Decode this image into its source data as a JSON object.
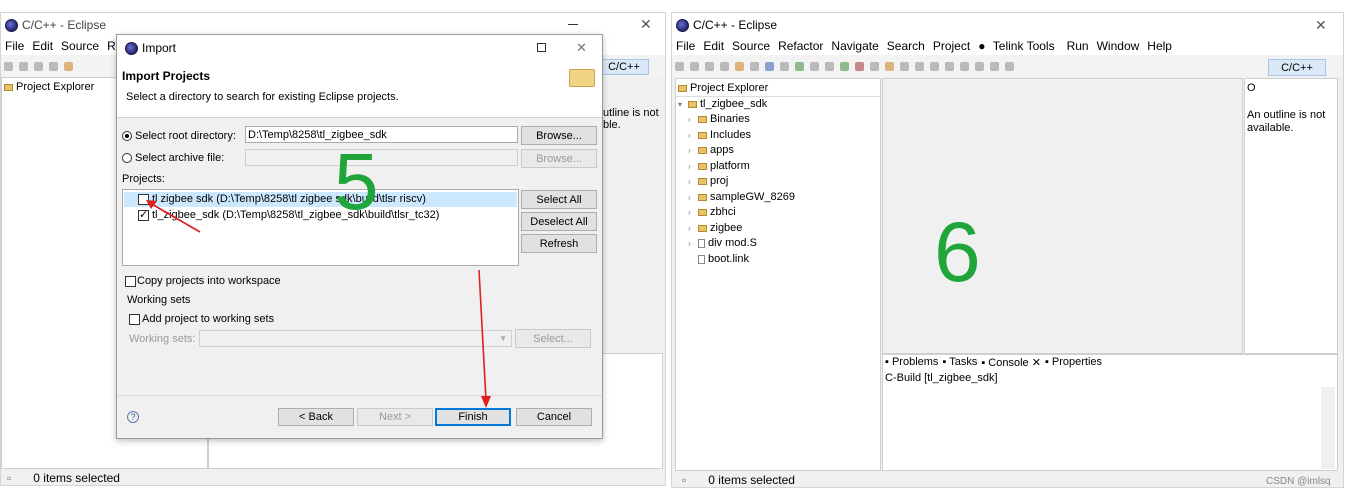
{
  "left_window": {
    "title": "C/C++ - Eclipse",
    "menu": [
      "File",
      "Edit",
      "Source",
      "Refa"
    ],
    "perspective_label": "C/C++",
    "project_explorer_tab": "Project Explorer",
    "outline_text": "utline is not\nble.",
    "status_text": "0 items selected"
  },
  "dialog": {
    "title": "Import",
    "header_title": "Import Projects",
    "header_desc": "Select a directory to search for existing Eclipse projects.",
    "root_dir_label": "Select root directory:",
    "root_dir_value": "D:\\Temp\\8258\\tl_zigbee_sdk",
    "archive_label": "Select archive file:",
    "browse_label": "Browse...",
    "browse_label_disabled": "Browse...",
    "projects_label": "Projects:",
    "projects": [
      {
        "label": "tl zigbee sdk (D:\\Temp\\8258\\tl zigbee sdk\\build\\tlsr riscv)",
        "checked": false
      },
      {
        "label": "tl_zigbee_sdk (D:\\Temp\\8258\\tl_zigbee_sdk\\build\\tlsr_tc32)",
        "checked": true
      }
    ],
    "select_all": "Select All",
    "deselect_all": "Deselect All",
    "refresh": "Refresh",
    "copy_label": "Copy projects into workspace",
    "working_sets_title": "Working sets",
    "add_ws_label": "Add project to working sets",
    "ws_label": "Working sets:",
    "ws_select": "Select...",
    "back": "< Back",
    "next": "Next >",
    "finish": "Finish",
    "cancel": "Cancel",
    "help_glyph": "?"
  },
  "annotation_5": "5",
  "annotation_6": "6",
  "right_window": {
    "title": "C/C++ - Eclipse",
    "menu": [
      "File",
      "Edit",
      "Source",
      "Refactor",
      "Navigate",
      "Search",
      "Project",
      "Telink Tools",
      "Run",
      "Window",
      "Help"
    ],
    "perspective_label": "C/C++",
    "project_explorer_tab": "Project Explorer",
    "outline_tab": "O",
    "outline_text": "An outline is not available.",
    "tree": [
      {
        "label": "tl_zigbee_sdk",
        "type": "project",
        "level": 0
      },
      {
        "label": "Binaries",
        "type": "folder",
        "level": 1
      },
      {
        "label": "Includes",
        "type": "folder",
        "level": 1
      },
      {
        "label": "apps",
        "type": "folder",
        "level": 1
      },
      {
        "label": "platform",
        "type": "folder",
        "level": 1
      },
      {
        "label": "proj",
        "type": "folder",
        "level": 1
      },
      {
        "label": "sampleGW_8269",
        "type": "folder",
        "level": 1
      },
      {
        "label": "zbhci",
        "type": "folder",
        "level": 1
      },
      {
        "label": "zigbee",
        "type": "folder",
        "level": 1
      },
      {
        "label": "div mod.S",
        "type": "file",
        "level": 1
      },
      {
        "label": "boot.link",
        "type": "file",
        "level": 1
      }
    ],
    "bottom_tabs": [
      "Problems",
      "Tasks",
      "Console",
      "Properties"
    ],
    "console_text": "C-Build [tl_zigbee_sdk]",
    "status_text": "0 items selected"
  },
  "watermark": "CSDN @imlsq",
  "colors": {
    "annotation_green": "#1fa53a",
    "arrow_red": "#e02020",
    "selection_blue": "#cce8ff",
    "default_button_border": "#0078d7"
  }
}
